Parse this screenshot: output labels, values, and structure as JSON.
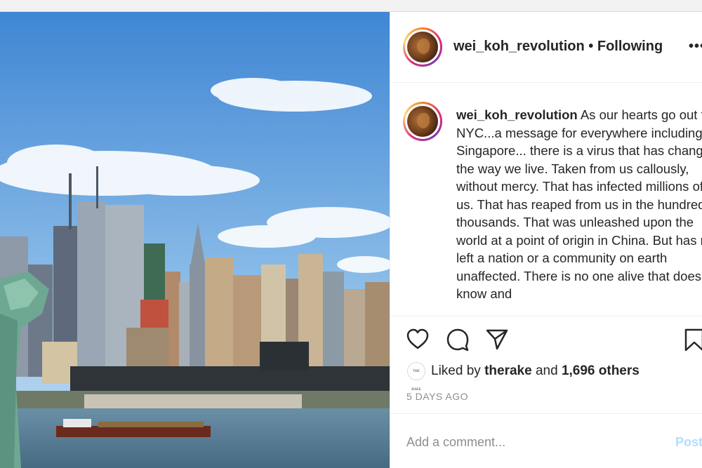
{
  "post": {
    "username": "wei_koh_revolution",
    "separator": "•",
    "follow_status": "Following",
    "more_label": "•••"
  },
  "caption": {
    "username": "wei_koh_revolution",
    "text": "As our hearts go out to NYC...a message for everywhere including Singapore... there is a virus that has changed the way we live. Taken from us callously, without mercy. That has infected millions of us. That has reaped from us in the hundred thousands. That was unleashed upon the world at a point of origin in China. But has not left a nation or a community on earth unaffected. There is no one alive that does not know and"
  },
  "actions": {
    "like_icon": "heart-icon",
    "comment_icon": "comment-icon",
    "share_icon": "paper-plane-icon",
    "save_icon": "bookmark-icon"
  },
  "likes": {
    "badge_text": "THE RAKE",
    "prefix": "Liked by",
    "liker": "therake",
    "conjunction": "and",
    "others": "1,696 others"
  },
  "timestamp": "5 DAYS AGO",
  "comment_box": {
    "placeholder": "Add a comment...",
    "post_label": "Post"
  },
  "colors": {
    "post_button": "#b2dffc",
    "muted_text": "#8e8e8e"
  }
}
